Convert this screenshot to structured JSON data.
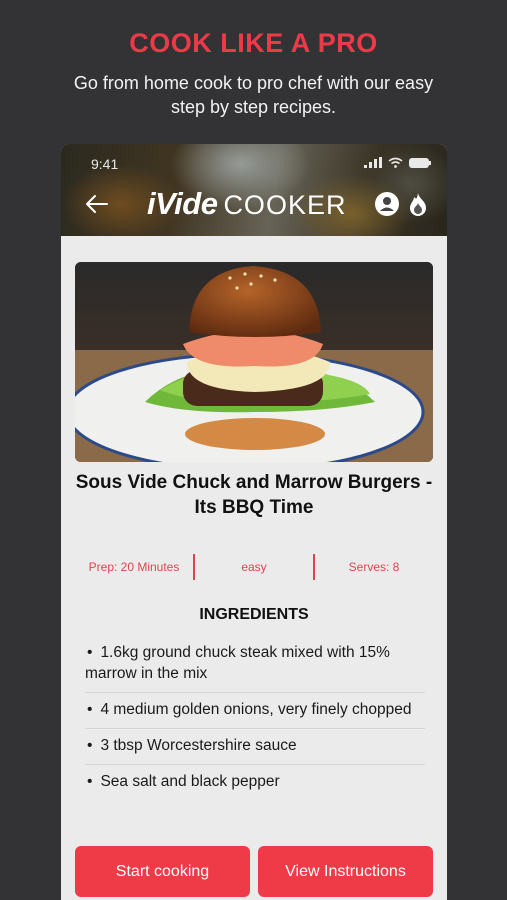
{
  "promo": {
    "headline": "COOK LIKE A PRO",
    "subtitle": "Go from home cook to pro chef with our easy step by step recipes."
  },
  "status_bar": {
    "time": "9:41"
  },
  "header": {
    "brand_bold": "iVide",
    "brand_light": "COOKER",
    "icons": [
      "back-arrow-icon",
      "user-icon",
      "flame-icon"
    ]
  },
  "recipe": {
    "title": "Sous Vide Chuck and Marrow Burgers - Its BBQ Time",
    "prep": "Prep: 20 Minutes",
    "difficulty": "easy",
    "serves": "Serves: 8"
  },
  "ingredients": {
    "heading": "INGREDIENTS",
    "items": [
      "1.6kg ground chuck steak mixed with 15% marrow in the mix",
      "4 medium golden onions, very finely chopped",
      "3 tbsp Worcestershire sauce",
      "Sea salt and black pepper"
    ]
  },
  "actions": {
    "start_label": "Start cooking",
    "instructions_label": "View Instructions"
  },
  "colors": {
    "accent": "#ef3a47",
    "background": "#333335",
    "panel": "#ebebeb"
  }
}
